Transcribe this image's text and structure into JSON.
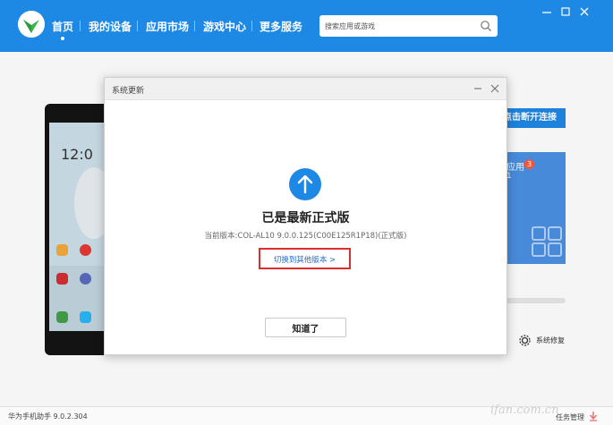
{
  "nav": {
    "items": [
      {
        "label": "首页",
        "active": true
      },
      {
        "label": "我的设备",
        "active": false
      },
      {
        "label": "应用市场",
        "active": false
      },
      {
        "label": "游戏中心",
        "active": false
      },
      {
        "label": "更多服务",
        "active": false
      }
    ]
  },
  "search": {
    "placeholder": "搜索应用或游戏"
  },
  "colors": {
    "brand": "#1e88e5",
    "highlight_box": "#d9302c",
    "link": "#1e6fd9"
  },
  "background": {
    "phone": {
      "clock": "12:0"
    },
    "disconnect_label": "点击断开连接",
    "apps_label": "应用",
    "apps_badge": "3",
    "apps_count": "1",
    "repair_label": "系统修复"
  },
  "dialog": {
    "title": "系统更新",
    "headline": "已是最新正式版",
    "current_version": "当前版本:COL-AL10 9.0.0.125(C00E125R1P18)(正式版)",
    "switch_link": "切换到其他版本 >",
    "ok_label": "知道了"
  },
  "status": {
    "version": "华为手机助手 9.0.2.304",
    "task_manager": "任务管理"
  },
  "watermark": "ifan.com.cn"
}
